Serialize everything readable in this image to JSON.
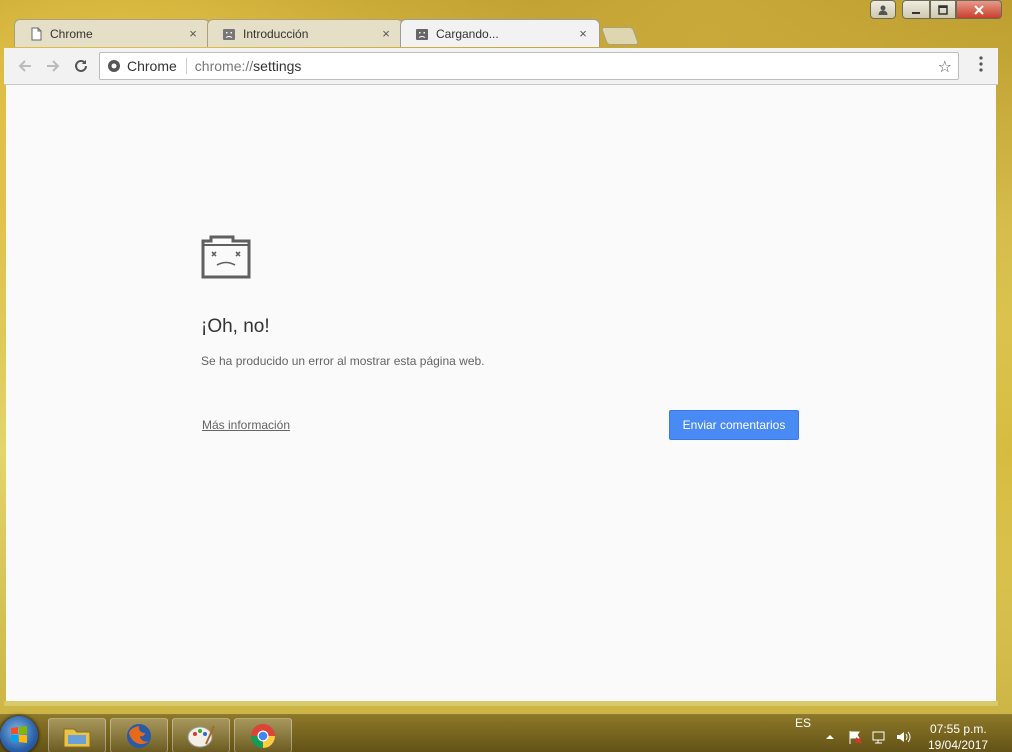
{
  "tabs": [
    {
      "label": "Chrome",
      "favicon": "page-icon",
      "close": "×"
    },
    {
      "label": "Introducción",
      "favicon": "sad-tab-icon",
      "close": "×"
    },
    {
      "label": "Cargando...",
      "favicon": "sad-tab-icon",
      "close": "×"
    }
  ],
  "window_controls": {
    "minimize": "▁",
    "maximize": "□",
    "close": "✕",
    "user": "👤"
  },
  "toolbar": {
    "back": "←",
    "forward": "→",
    "reload": "↻",
    "omnibox_chip": "Chrome",
    "url_scheme": "chrome://",
    "url_path": "settings",
    "star": "☆",
    "menu": "⋮"
  },
  "error_page": {
    "title": "¡Oh, no!",
    "message": "Se ha producido un error al mostrar esta página web.",
    "more_info": "Más información",
    "feedback_button": "Enviar comentarios"
  },
  "taskbar": {
    "language": "ES",
    "time": "07:55 p.m.",
    "date": "19/04/2017",
    "apps": [
      "file-explorer-icon",
      "firefox-icon",
      "paint-icon",
      "chrome-icon"
    ]
  },
  "colors": {
    "accent": "#4a8af4",
    "content_bg": "#fafafa"
  }
}
